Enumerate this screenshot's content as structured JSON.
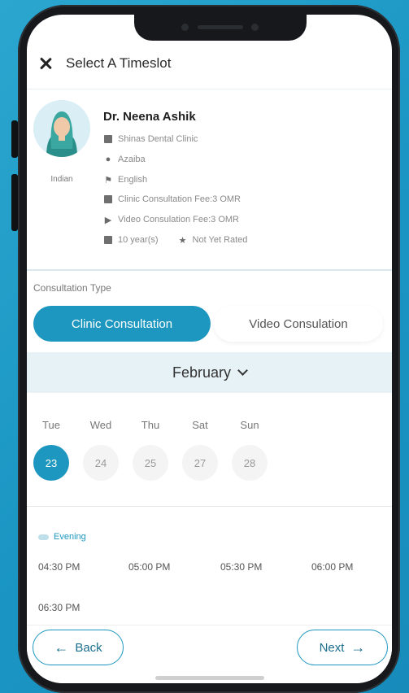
{
  "header": {
    "title": "Select A Timeslot"
  },
  "doctor": {
    "name": "Dr. Neena Ashik",
    "nationality": "Indian",
    "clinic": "Shinas Dental Clinic",
    "location": "Azaiba",
    "language": "English",
    "clinic_fee": "Clinic Consultation Fee:3 OMR",
    "video_fee": "Video Consulation Fee:3 OMR",
    "experience": "10 year(s)",
    "rating": "Not Yet Rated"
  },
  "consultation": {
    "label": "Consultation Type",
    "options": [
      "Clinic Consultation",
      "Video Consulation"
    ],
    "selected": "Clinic Consultation"
  },
  "calendar": {
    "month": "February",
    "days": [
      {
        "name": "Tue",
        "date": "23",
        "selected": true
      },
      {
        "name": "Wed",
        "date": "24",
        "selected": false
      },
      {
        "name": "Thu",
        "date": "25",
        "selected": false
      },
      {
        "name": "Sat",
        "date": "27",
        "selected": false
      },
      {
        "name": "Sun",
        "date": "28",
        "selected": false
      }
    ]
  },
  "timeslots": {
    "period": "Evening",
    "slots": [
      "04:30 PM",
      "05:00 PM",
      "05:30 PM",
      "06:00 PM",
      "06:30 PM"
    ]
  },
  "footer": {
    "back_label": "Back",
    "next_label": "Next"
  },
  "colors": {
    "accent": "#1d97bf",
    "background": "#1a95c3"
  }
}
